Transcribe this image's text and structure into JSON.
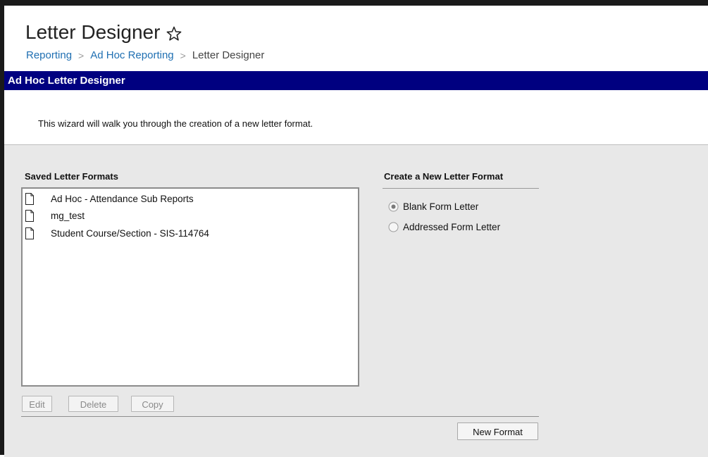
{
  "header": {
    "title": "Letter Designer",
    "star_icon": "star-outline-icon",
    "breadcrumb": [
      "Reporting",
      "Ad Hoc Reporting",
      "Letter Designer"
    ],
    "separator": ">"
  },
  "panel": {
    "title": "Ad Hoc Letter Designer",
    "title_bg": "#000080",
    "intro": "This wizard will walk you through the creation of a new letter format."
  },
  "saved": {
    "heading": "Saved Letter Formats",
    "items": [
      {
        "label": "Ad Hoc - Attendance Sub Reports",
        "icon": "document-icon"
      },
      {
        "label": "mg_test",
        "icon": "document-icon"
      },
      {
        "label": "Student Course/Section - SIS-114764",
        "icon": "document-icon"
      }
    ],
    "buttons": {
      "edit": "Edit",
      "delete": "Delete",
      "copy": "Copy"
    }
  },
  "create": {
    "heading": "Create a New Letter Format",
    "options": [
      {
        "label": "Blank Form Letter",
        "selected": true
      },
      {
        "label": "Addressed Form Letter",
        "selected": false
      }
    ],
    "new_button": "New Format"
  }
}
